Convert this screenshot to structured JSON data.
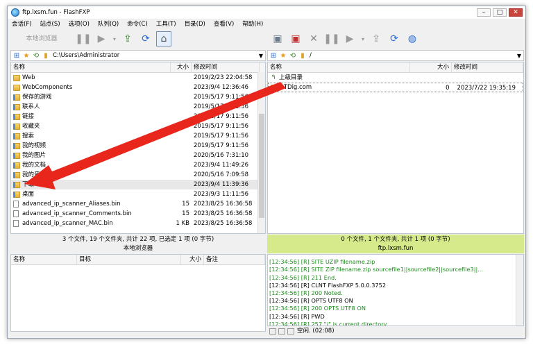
{
  "window": {
    "title": "ftp.lxsm.fun - FlashFXP"
  },
  "menu": [
    "会话(F)",
    "站点(S)",
    "选项(O)",
    "队列(Q)",
    "命令(C)",
    "工具(T)",
    "目录(D)",
    "查看(V)",
    "帮助(H)"
  ],
  "toolbar_left": {
    "browser_label": "本地浏览器"
  },
  "path_left": {
    "value": "C:\\Users\\Administrator"
  },
  "path_right": {
    "value": "/"
  },
  "left_pane": {
    "columns": [
      "名称",
      "大小",
      "修改时间"
    ],
    "rows": [
      {
        "name": "Web",
        "size": "",
        "modified": "2019/2/23 22:04:58",
        "icon": "folder"
      },
      {
        "name": "WebComponents",
        "size": "",
        "modified": "2023/9/4 12:36:46",
        "icon": "folder"
      },
      {
        "name": "保存的游戏",
        "size": "",
        "modified": "2019/5/17 9:11:56",
        "icon": "special"
      },
      {
        "name": "联系人",
        "size": "",
        "modified": "2019/5/17 9:11:56",
        "icon": "special"
      },
      {
        "name": "链接",
        "size": "",
        "modified": "2019/5/17 9:11:56",
        "icon": "special"
      },
      {
        "name": "收藏夹",
        "size": "",
        "modified": "2019/5/17 9:11:56",
        "icon": "special"
      },
      {
        "name": "搜索",
        "size": "",
        "modified": "2019/5/17 9:11:56",
        "icon": "special"
      },
      {
        "name": "我的视频",
        "size": "",
        "modified": "2019/5/17 9:11:56",
        "icon": "special"
      },
      {
        "name": "我的图片",
        "size": "",
        "modified": "2020/5/16 7:31:10",
        "icon": "special"
      },
      {
        "name": "我的文档",
        "size": "",
        "modified": "2023/9/4 11:49:26",
        "icon": "special"
      },
      {
        "name": "我的音乐",
        "size": "",
        "modified": "2020/5/16 7:09:58",
        "icon": "special"
      },
      {
        "name": "下载",
        "size": "",
        "modified": "2023/9/4 11:39:36",
        "icon": "special"
      },
      {
        "name": "桌面",
        "size": "",
        "modified": "2023/9/3 11:11:56",
        "icon": "special"
      },
      {
        "name": "advanced_ip_scanner_Aliases.bin",
        "size": "15",
        "modified": "2023/8/25 16:36:58",
        "icon": "file"
      },
      {
        "name": "advanced_ip_scanner_Comments.bin",
        "size": "15",
        "modified": "2023/8/25 16:36:58",
        "icon": "file"
      },
      {
        "name": "advanced_ip_scanner_MAC.bin",
        "size": "1 KB",
        "modified": "2023/8/25 16:36:58",
        "icon": "file"
      }
    ]
  },
  "right_pane": {
    "columns": [
      "名称",
      "大小",
      "修改时间"
    ],
    "rows": [
      {
        "name": "上级目录",
        "size": "",
        "modified": "",
        "icon": "up"
      },
      {
        "name": "BTDig.com",
        "size": "0",
        "modified": "2023/7/22 19:35:19",
        "icon": "folder"
      }
    ]
  },
  "status_left": "3 个文件, 19 个文件夹, 共计 22 项, 已选定 1 项 (0 字节)",
  "status_right": "0 个文件, 1 个文件夹, 共计 1 项 (0 字节)",
  "site_left": "本地浏览器",
  "site_right": "ftp.lxsm.fun",
  "queue": {
    "columns": [
      "名称",
      "目标",
      "大小",
      "备注"
    ]
  },
  "log": [
    {
      "text": "[12:34:56] [R]  SITE UZIP filename.zip",
      "color": "green"
    },
    {
      "text": "[12:34:56] [R]  SITE ZIP filename.zip sourcefile1||sourcefile2||sourcefile3||...",
      "color": "green"
    },
    {
      "text": "[12:34:56] [R] 211 End.",
      "color": "green"
    },
    {
      "text": "[12:34:56] [R] CLNT FlashFXP 5.0.0.3752",
      "color": "black"
    },
    {
      "text": "[12:34:56] [R] 200 Noted.",
      "color": "green"
    },
    {
      "text": "[12:34:56] [R] OPTS UTF8 ON",
      "color": "black"
    },
    {
      "text": "[12:34:56] [R] 200 OPTS UTF8 ON",
      "color": "green"
    },
    {
      "text": "[12:34:56] [R] PWD",
      "color": "black"
    },
    {
      "text": "[12:34:56] [R] 257 \"/\" is current directory.",
      "color": "green"
    }
  ],
  "bottom_status": "空闲. (02:08)",
  "colors": {
    "connected_bar": "#d6ea8c",
    "log_green": "#1a8a1a",
    "arrow_red": "#e8261c"
  }
}
